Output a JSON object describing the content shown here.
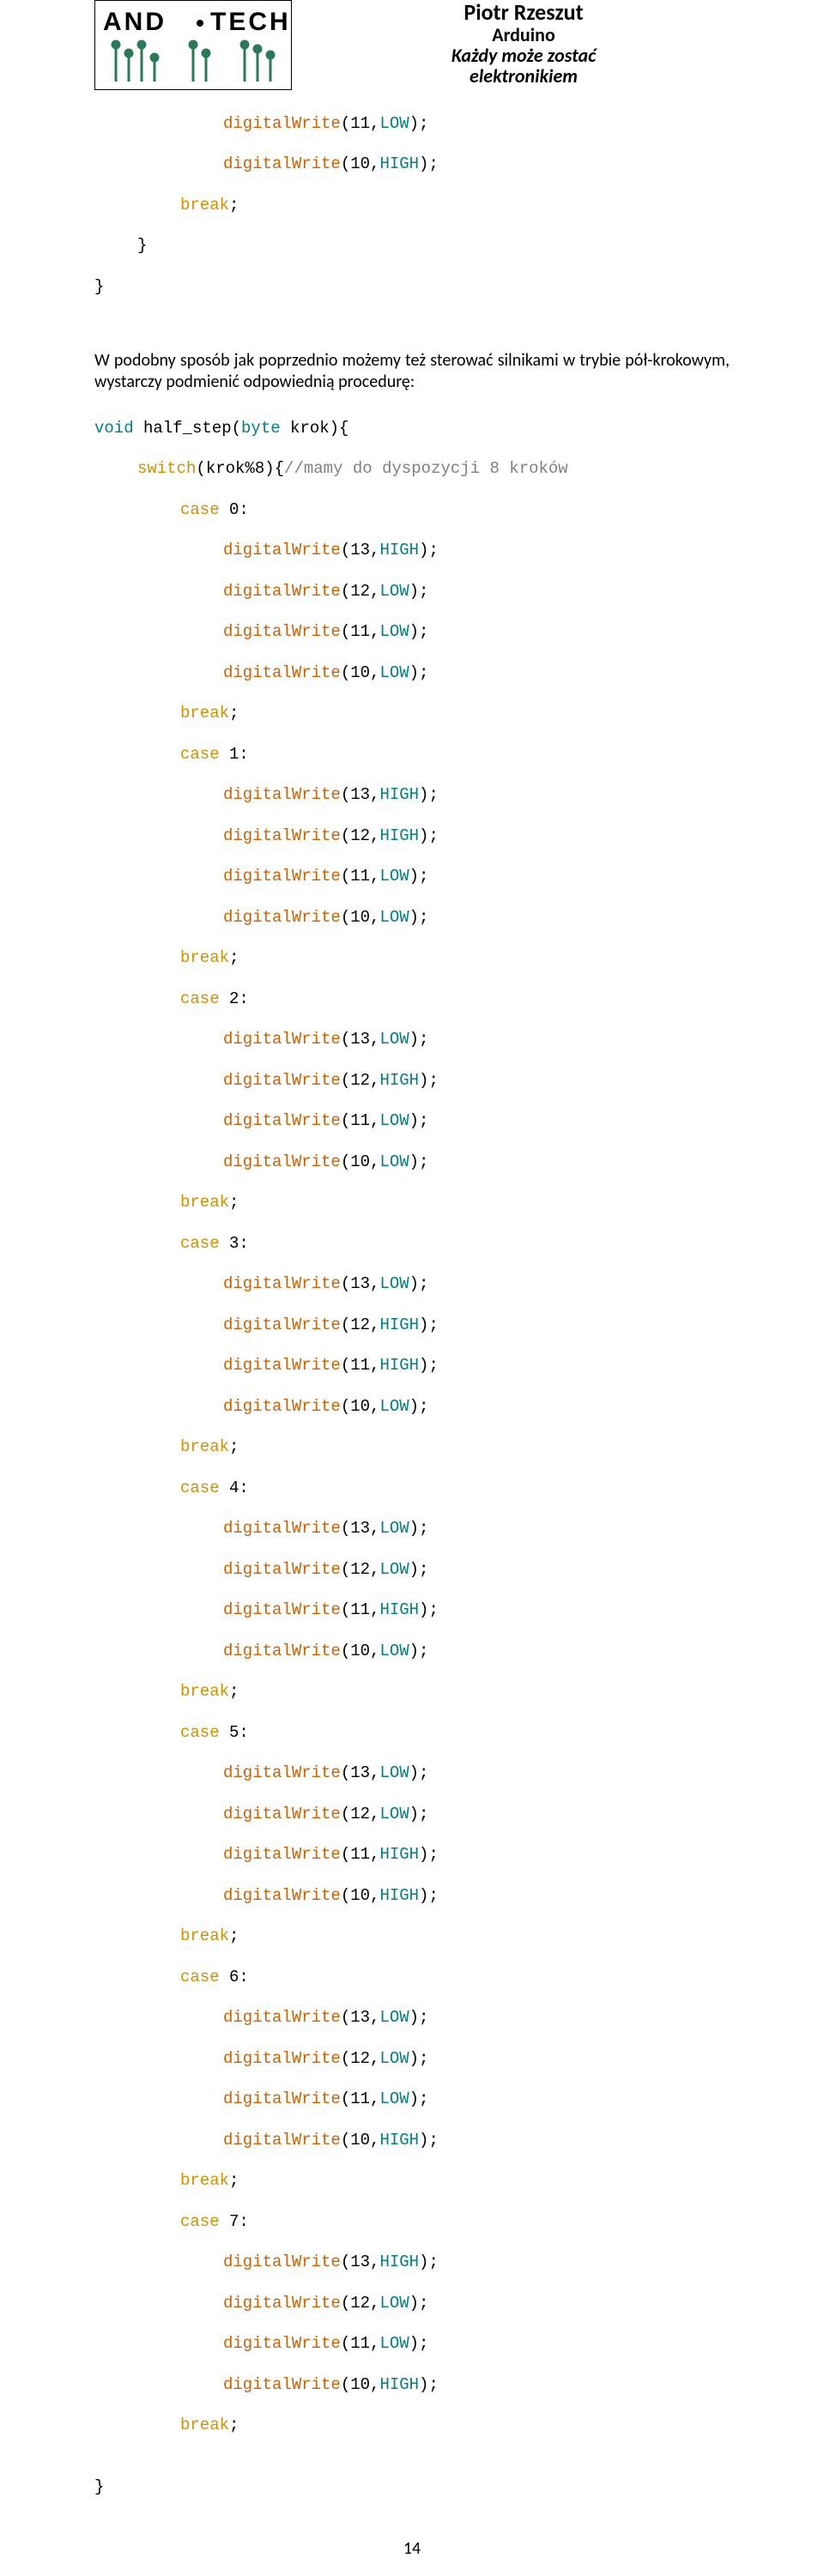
{
  "header": {
    "author": "Piotr Rzeszut",
    "line1": "Arduino",
    "line2": "Każdy może zostać",
    "line3": "elektronikiem",
    "logo_text": "AND•TECH"
  },
  "intro_paragraph": "W podobny sposób jak poprzednio możemy też sterować silnikami w trybie pół-krokowym, wystarczy podmienić odpowiednią procedurę:",
  "tokens": {
    "digitalWrite": "digitalWrite",
    "void": "void",
    "byte": "byte",
    "switch": "switch",
    "case": "case",
    "break": "break",
    "HIGH": "HIGH",
    "LOW": "LOW"
  },
  "snippet1": {
    "l1_fn": "digitalWrite",
    "l1_args_a": "(11,",
    "l1_const": "LOW",
    "l1_close": ");",
    "l2_fn": "digitalWrite",
    "l2_args_a": "(10,",
    "l2_const": "HIGH",
    "l2_close": ");",
    "l3": "break",
    "l3_semi": ";",
    "l4": "}",
    "l5": "}"
  },
  "snippet2": {
    "sig_void": "void",
    "sig_name": " half_step(",
    "sig_byte": "byte",
    "sig_tail": " krok){",
    "sw": "switch",
    "sw_tail": "(krok%8){",
    "sw_comment": "//mamy do dyspozycji 8 kroków",
    "close_brace": "}"
  },
  "cases": [
    {
      "label": "case",
      "num": " 0:",
      "lines": [
        {
          "n": "13",
          "v": "HIGH"
        },
        {
          "n": "12",
          "v": "LOW"
        },
        {
          "n": "11",
          "v": "LOW"
        },
        {
          "n": "10",
          "v": "LOW"
        }
      ]
    },
    {
      "label": "case",
      "num": " 1:",
      "lines": [
        {
          "n": "13",
          "v": "HIGH"
        },
        {
          "n": "12",
          "v": "HIGH"
        },
        {
          "n": "11",
          "v": "LOW"
        },
        {
          "n": "10",
          "v": "LOW"
        }
      ]
    },
    {
      "label": "case",
      "num": " 2:",
      "lines": [
        {
          "n": "13",
          "v": "LOW"
        },
        {
          "n": "12",
          "v": "HIGH"
        },
        {
          "n": "11",
          "v": "LOW"
        },
        {
          "n": "10",
          "v": "LOW"
        }
      ]
    },
    {
      "label": "case",
      "num": " 3:",
      "lines": [
        {
          "n": "13",
          "v": "LOW"
        },
        {
          "n": "12",
          "v": "HIGH"
        },
        {
          "n": "11",
          "v": "HIGH"
        },
        {
          "n": "10",
          "v": "LOW"
        }
      ]
    },
    {
      "label": "case",
      "num": " 4:",
      "lines": [
        {
          "n": "13",
          "v": "LOW"
        },
        {
          "n": "12",
          "v": "LOW"
        },
        {
          "n": "11",
          "v": "HIGH"
        },
        {
          "n": "10",
          "v": "LOW"
        }
      ]
    },
    {
      "label": "case",
      "num": " 5:",
      "lines": [
        {
          "n": "13",
          "v": "LOW"
        },
        {
          "n": "12",
          "v": "LOW"
        },
        {
          "n": "11",
          "v": "HIGH"
        },
        {
          "n": "10",
          "v": "HIGH"
        }
      ]
    },
    {
      "label": "case",
      "num": " 6:",
      "lines": [
        {
          "n": "13",
          "v": "LOW"
        },
        {
          "n": "12",
          "v": "LOW"
        },
        {
          "n": "11",
          "v": "LOW"
        },
        {
          "n": "10",
          "v": "HIGH"
        }
      ]
    },
    {
      "label": "case",
      "num": " 7:",
      "lines": [
        {
          "n": "13",
          "v": "HIGH"
        },
        {
          "n": "12",
          "v": "LOW"
        },
        {
          "n": "11",
          "v": "LOW"
        },
        {
          "n": "10",
          "v": "HIGH"
        }
      ]
    }
  ],
  "break_kw": "break",
  "break_semi": ";",
  "dw_open": "(",
  "dw_comma": ",",
  "dw_close": ");",
  "page_number": "14"
}
